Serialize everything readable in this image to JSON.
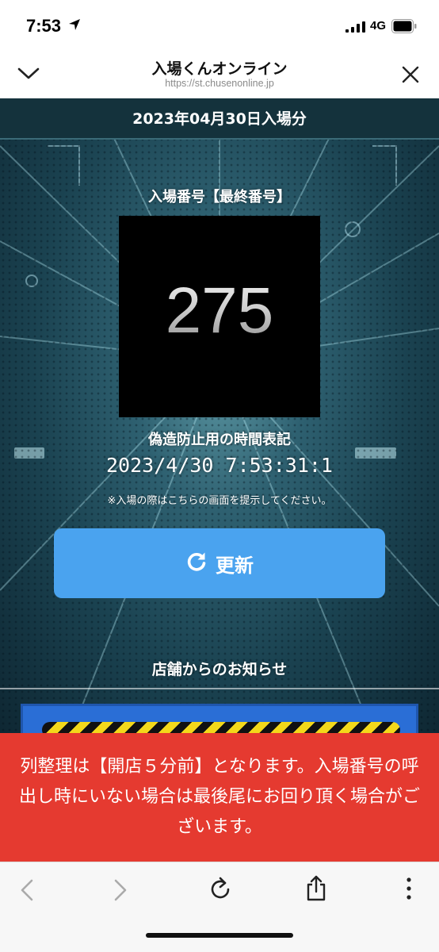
{
  "status_bar": {
    "time": "7:53",
    "network": "4G"
  },
  "nav": {
    "title": "入場くんオンライン",
    "url": "https://st.chusenonline.jp"
  },
  "main": {
    "date_banner": "2023年04月30日入場分",
    "entry_label": "入場番号【最終番号】",
    "entry_number": "275",
    "anti_forgery_label": "偽造防止用の時間表記",
    "timestamp": "2023/4/30 7:53:31:1",
    "notice_small": "※入場の際はこちらの画面を提示してください。",
    "refresh_label": "更新",
    "store_notice_title": "店舗からのお知らせ"
  },
  "overlay": {
    "text": "列整理は【開店５分前】となります。入場番号の呼出し時にいない場合は最後尾にお回り頂く場合がございます。"
  },
  "colors": {
    "refresh_button": "#4aa3ef",
    "overlay_banner": "#e53a30",
    "date_banner": "#14323c"
  },
  "icons": {
    "status": [
      "location-arrow-icon",
      "signal-icon",
      "battery-icon"
    ],
    "nav": [
      "chevron-down-icon",
      "close-icon"
    ],
    "button": "refresh-icon",
    "toolbar": [
      "back-icon",
      "forward-icon",
      "reload-icon",
      "share-icon",
      "more-icon"
    ]
  }
}
